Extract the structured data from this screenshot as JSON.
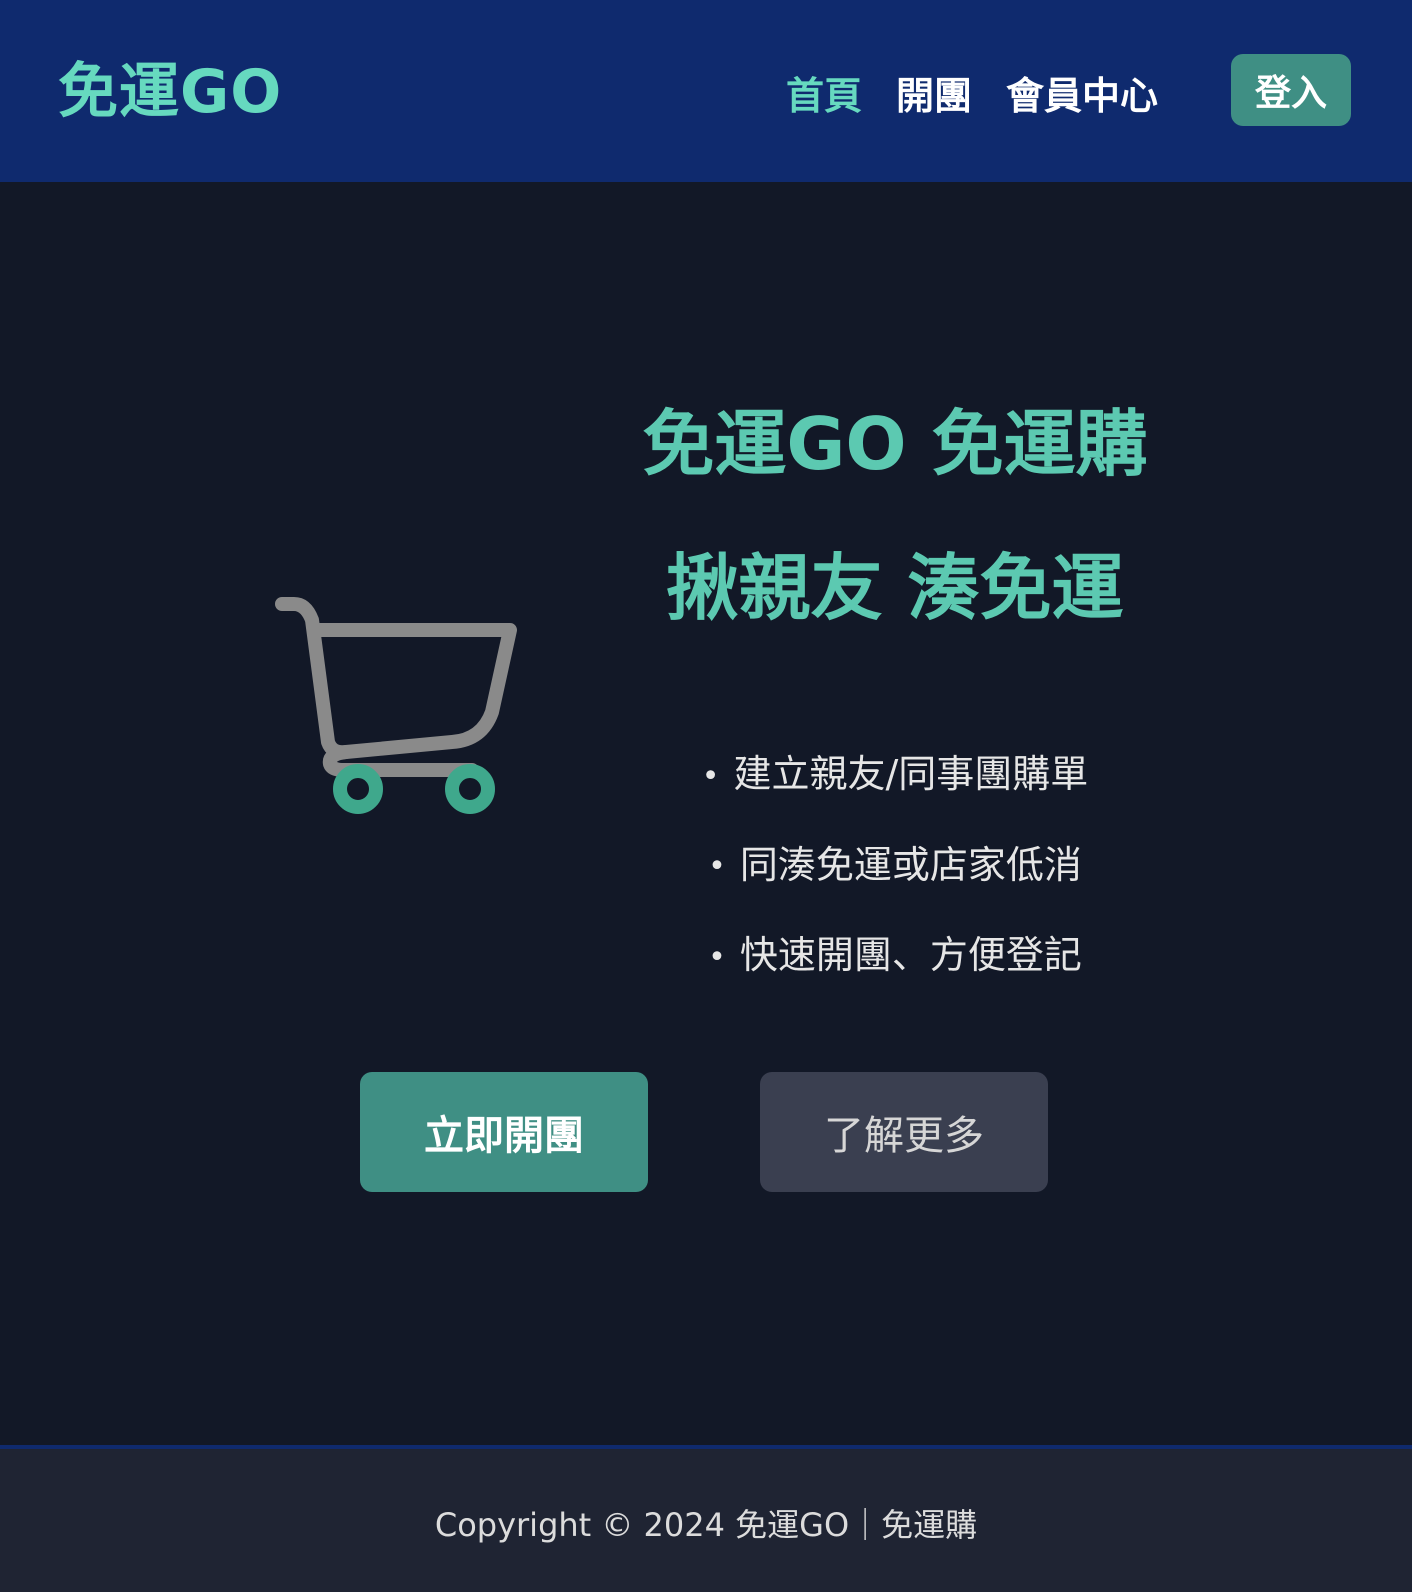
{
  "brand": {
    "logo": "免運GO",
    "accent_color": "#66d9bf",
    "primary_button_color": "#3f8f84"
  },
  "nav": {
    "items": [
      {
        "label": "首頁",
        "active": true
      },
      {
        "label": "開團",
        "active": false
      },
      {
        "label": "會員中心",
        "active": false
      }
    ],
    "login_label": "登入"
  },
  "hero": {
    "icon": "shopping-cart-icon",
    "title_line1": "免運GO 免運購",
    "title_line2": "揪親友 湊免運",
    "bullet": "•",
    "features": [
      "建立親友/同事團購單",
      "同湊免運或店家低消",
      "快速開團、方便登記"
    ]
  },
  "actions": {
    "primary_label": "立即開團",
    "secondary_label": "了解更多"
  },
  "footer": {
    "copyright": "Copyright © 2024 免運GO｜免運購"
  }
}
